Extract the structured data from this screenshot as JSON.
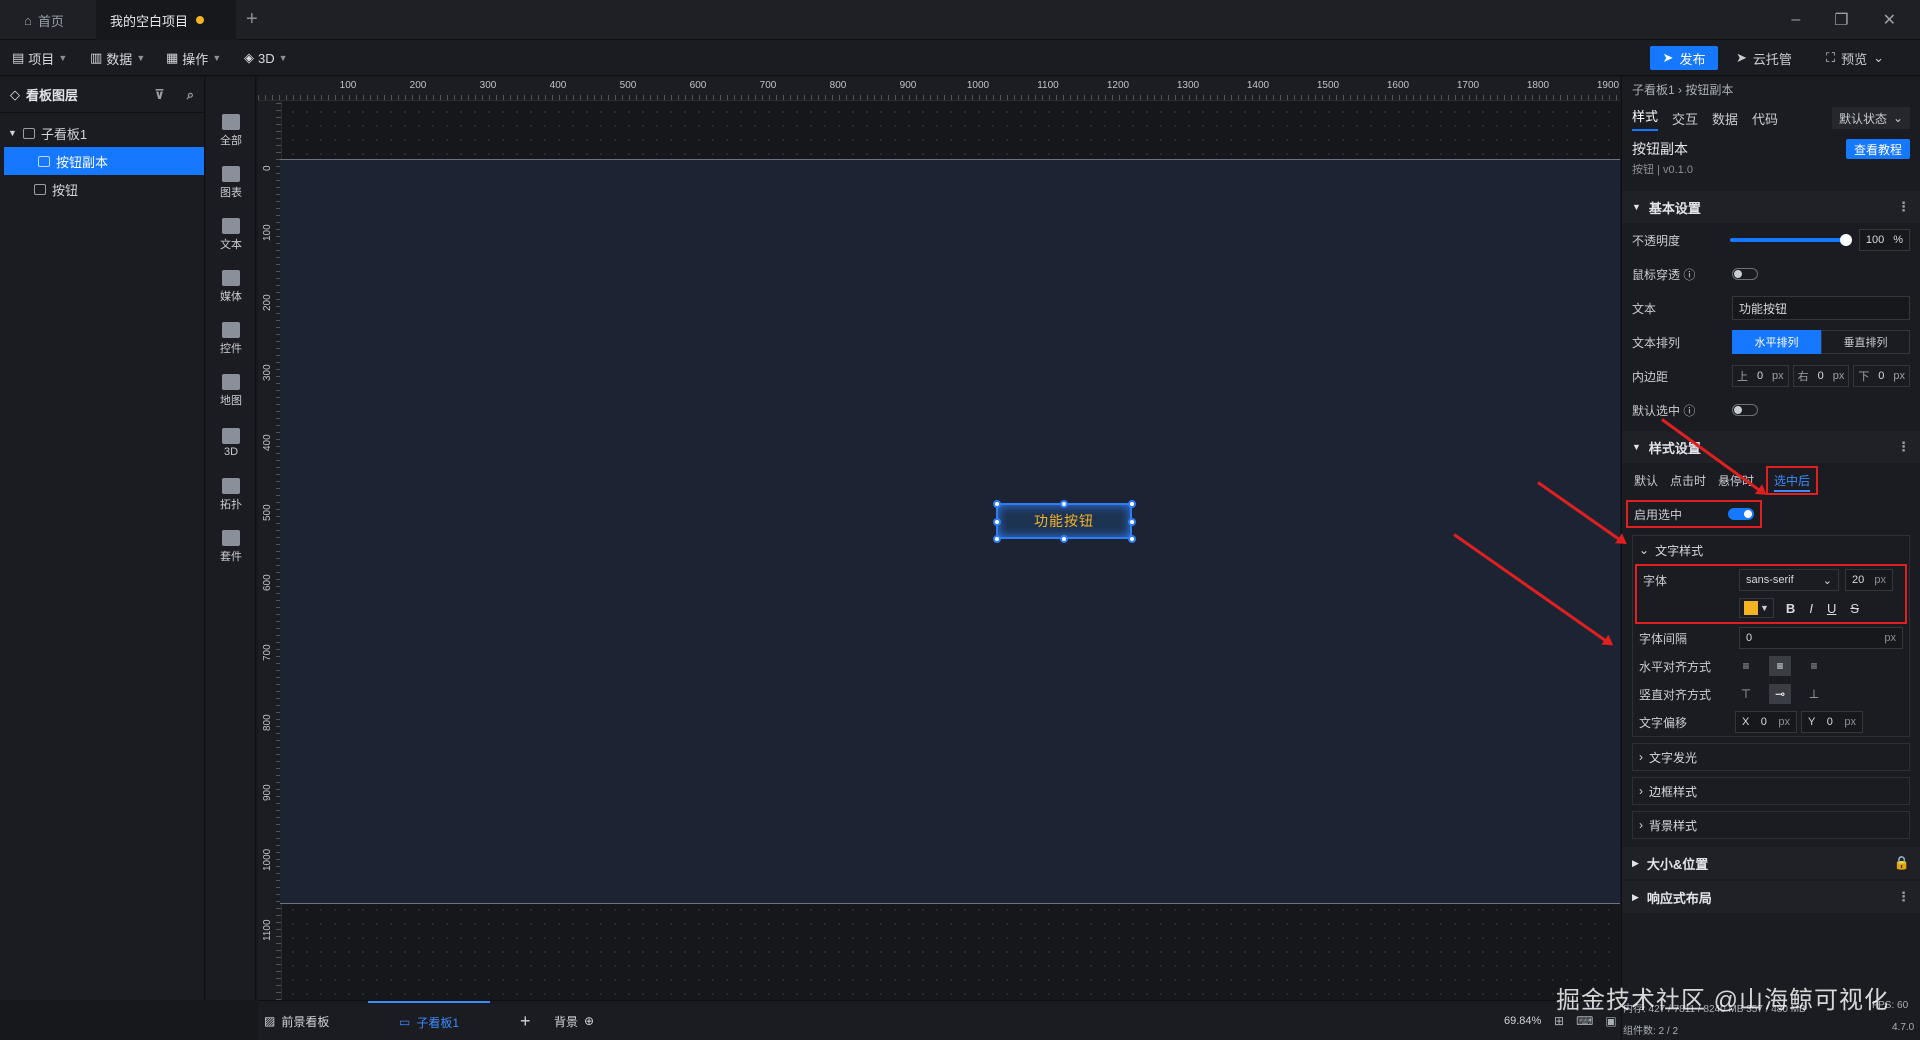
{
  "tabs": {
    "home": "首页",
    "project": "我的空白项目"
  },
  "toolbar": {
    "menus": [
      "项目",
      "数据",
      "操作",
      "3D"
    ],
    "publish": "发布",
    "cloud": "云托管",
    "preview": "预览"
  },
  "layers": {
    "title": "看板图层",
    "root": "子看板1",
    "items": [
      "按钮副本",
      "按钮"
    ]
  },
  "components": [
    "全部",
    "图表",
    "文本",
    "媒体",
    "控件",
    "地图",
    "3D",
    "拓扑",
    "套件"
  ],
  "ruler": {
    "top": [
      "100",
      "200",
      "300",
      "400",
      "500",
      "600",
      "700",
      "800",
      "900",
      "1000",
      "1100",
      "1200",
      "1300",
      "1400",
      "1500",
      "1600",
      "1700",
      "1800",
      "1900"
    ],
    "left": [
      "0",
      "100",
      "200",
      "300",
      "400",
      "500",
      "600",
      "700",
      "800",
      "900",
      "1000",
      "1100",
      "00"
    ]
  },
  "canvas": {
    "button_text": "功能按钮"
  },
  "bottom": {
    "front": "前景看板",
    "board": "子看板1",
    "bg": "背景",
    "zoom": "69.84%",
    "count": "组件数: 2 / 2",
    "mem": "内存: 427 / 7811 / 8240 MB  357 / 480 MB",
    "fps": "FPS: 60",
    "version": "4.7.0"
  },
  "props": {
    "breadcrumb": "子看板1 › 按钮副本",
    "tabs": [
      "样式",
      "交互",
      "数据",
      "代码"
    ],
    "state": "默认状态",
    "comp_name": "按钮副本",
    "comp_ver": "按钮 | v0.1.0",
    "tutorial": "查看教程",
    "basic": {
      "title": "基本设置",
      "opacity_label": "不透明度",
      "opacity_value": "100",
      "opacity_unit": "%",
      "mouse_label": "鼠标穿透",
      "text_label": "文本",
      "text_value": "功能按钮",
      "arrange_label": "文本排列",
      "arrange_h": "水平排列",
      "arrange_v": "垂直排列",
      "padding_label": "内边距",
      "pad_top": "上",
      "pad_right": "右",
      "pad_bottom": "下",
      "pad_value": "0",
      "px": "px",
      "default_sel_label": "默认选中"
    },
    "style": {
      "title": "样式设置",
      "tabs": [
        "默认",
        "点击时",
        "悬停时",
        "选中后"
      ],
      "enable_label": "启用选中",
      "text_style": "文字样式",
      "font_label": "字体",
      "font_value": "sans-serif",
      "font_size": "20",
      "spacing_label": "字体间隔",
      "spacing_value": "0",
      "halign_label": "水平对齐方式",
      "valign_label": "竖直对齐方式",
      "offset_label": "文字偏移",
      "x": "X",
      "y": "Y",
      "offset_value": "0",
      "glow": "文字发光",
      "border": "边框样式",
      "bg": "背景样式"
    },
    "size_pos": "大小&位置",
    "more": "响应式布局"
  },
  "watermark": "掘金技术社区 @山海鲸可视化",
  "colors": {
    "accent": "#1677ff",
    "highlight": "#e02020",
    "text_yellow": "#f5b324"
  }
}
